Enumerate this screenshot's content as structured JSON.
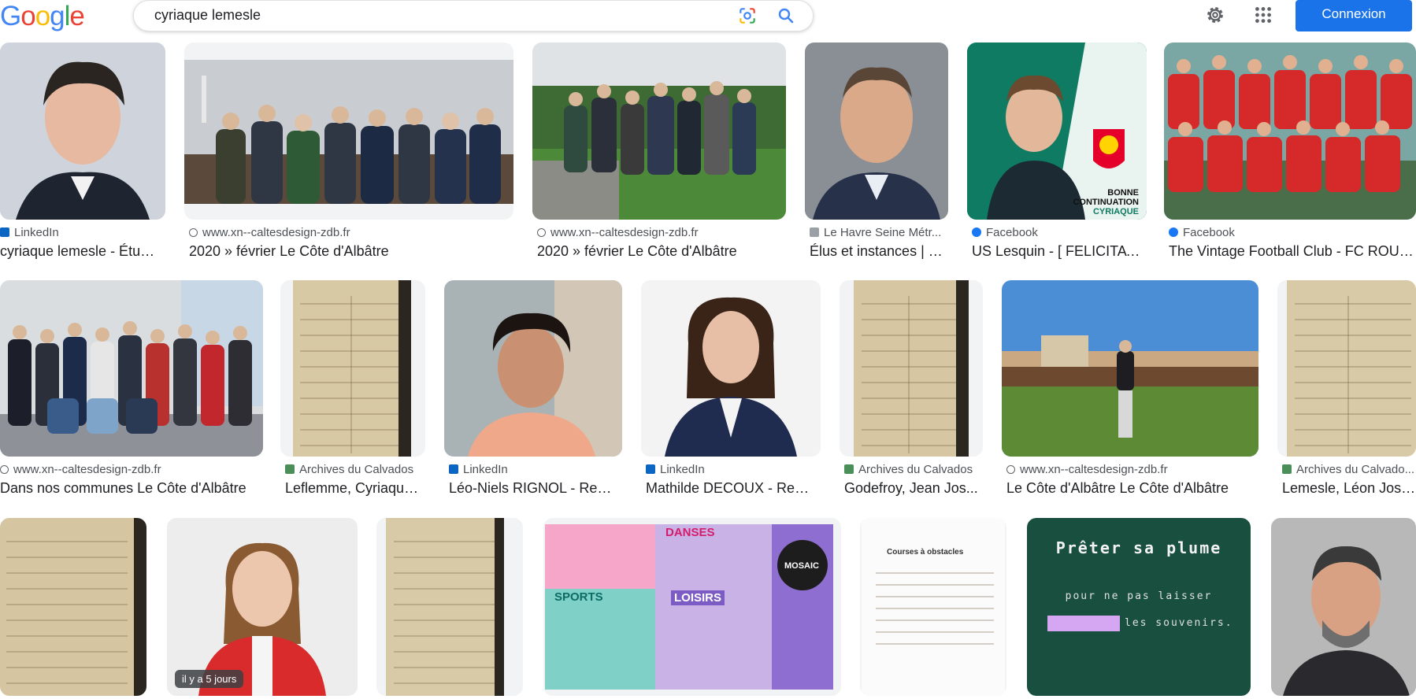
{
  "header": {
    "search_value": "cyriaque lemesle",
    "signin_label": "Connexion"
  },
  "logo_letters": [
    {
      "ch": "G",
      "color": "#4285f4"
    },
    {
      "ch": "o",
      "color": "#ea4335"
    },
    {
      "ch": "o",
      "color": "#fbbc05"
    },
    {
      "ch": "g",
      "color": "#4285f4"
    },
    {
      "ch": "l",
      "color": "#34a853"
    },
    {
      "ch": "e",
      "color": "#ea4335"
    }
  ],
  "colors": {
    "accent": "#1a73e8",
    "linkedin": "#0a66c2",
    "facebook": "#1877f2"
  },
  "results": [
    {
      "source": "LinkedIn",
      "source_icon": "linkedin-icon",
      "title": "cyriaque lemesle - Étudi..."
    },
    {
      "source": "www.xn--caltesdesign-zdb.fr",
      "source_icon": "globe-icon",
      "title": "2020 » février Le Côte d'Albâtre"
    },
    {
      "source": "www.xn--caltesdesign-zdb.fr",
      "source_icon": "globe-icon",
      "title": "2020 » février Le Côte d'Albâtre"
    },
    {
      "source": "Le Havre Seine Métr...",
      "source_icon": "site-icon",
      "title": "Élus et instances | L..."
    },
    {
      "source": "Facebook",
      "source_icon": "facebook-icon",
      "title": "US Lesquin - [ FELICITATI...",
      "image_text": [
        "BONNE",
        "CONTINUATION",
        "CYRIAQUE"
      ]
    },
    {
      "source": "Facebook",
      "source_icon": "facebook-icon",
      "title": "The Vintage Football Club - FC ROUE..."
    },
    {
      "source": "www.xn--caltesdesign-zdb.fr",
      "source_icon": "globe-icon",
      "title": "Dans nos communes Le Côte d'Albâtre"
    },
    {
      "source": "Archives du Calvados",
      "source_icon": "archive-icon",
      "title": "Leflemme, Cyriaque..."
    },
    {
      "source": "LinkedIn",
      "source_icon": "linkedin-icon",
      "title": "Léo-Niels RIGNOL - Renn..."
    },
    {
      "source": "LinkedIn",
      "source_icon": "linkedin-icon",
      "title": "Mathilde DECOUX - Resp..."
    },
    {
      "source": "Archives du Calvados",
      "source_icon": "archive-icon",
      "title": "Godefroy, Jean Jos..."
    },
    {
      "source": "www.xn--caltesdesign-zdb.fr",
      "source_icon": "globe-icon",
      "title": "Le Côte d'Albâtre Le Côte d'Albâtre"
    },
    {
      "source": "Archives du Calvado...",
      "source_icon": "archive-icon",
      "title": "Lemesle, Léon Jose..."
    },
    {
      "source": "",
      "title": ""
    },
    {
      "source": "",
      "title": "",
      "badge": "il y a 5 jours"
    },
    {
      "source": "",
      "title": ""
    },
    {
      "source": "",
      "title": "",
      "image_text": [
        "DANSES",
        "SPORTS",
        "LOISIRS",
        "MOSAIC"
      ]
    },
    {
      "source": "",
      "title": "",
      "image_text": [
        "Courses à obstacles"
      ]
    },
    {
      "source": "",
      "title": "",
      "image_text": [
        "Prêter sa plume",
        "pour ne pas laisser",
        "les souvenirs."
      ]
    },
    {
      "source": "",
      "title": ""
    }
  ]
}
